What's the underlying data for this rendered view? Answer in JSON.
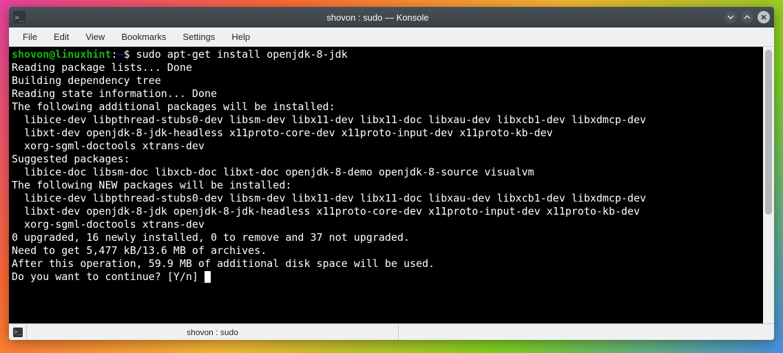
{
  "window": {
    "title": "shovon : sudo — Konsole"
  },
  "menubar": {
    "items": [
      "File",
      "Edit",
      "View",
      "Bookmarks",
      "Settings",
      "Help"
    ]
  },
  "prompt": {
    "userhost": "shovon@linuxhint",
    "sep": ":",
    "cwd": "~",
    "sigil": "$ ",
    "command": "sudo apt-get install openjdk-8-jdk"
  },
  "lines": {
    "l1": "Reading package lists... Done",
    "l2": "Building dependency tree       ",
    "l3": "Reading state information... Done",
    "l4": "The following additional packages will be installed:",
    "l5": "  libice-dev libpthread-stubs0-dev libsm-dev libx11-dev libx11-doc libxau-dev libxcb1-dev libxdmcp-dev",
    "l6": "  libxt-dev openjdk-8-jdk-headless x11proto-core-dev x11proto-input-dev x11proto-kb-dev",
    "l7": "  xorg-sgml-doctools xtrans-dev",
    "l8": "Suggested packages:",
    "l9": "  libice-doc libsm-doc libxcb-doc libxt-doc openjdk-8-demo openjdk-8-source visualvm",
    "l10": "The following NEW packages will be installed:",
    "l11": "  libice-dev libpthread-stubs0-dev libsm-dev libx11-dev libx11-doc libxau-dev libxcb1-dev libxdmcp-dev",
    "l12": "  libxt-dev openjdk-8-jdk openjdk-8-jdk-headless x11proto-core-dev x11proto-input-dev x11proto-kb-dev",
    "l13": "  xorg-sgml-doctools xtrans-dev",
    "l14": "0 upgraded, 16 newly installed, 0 to remove and 37 not upgraded.",
    "l15": "Need to get 5,477 kB/13.6 MB of archives.",
    "l16": "After this operation, 59.9 MB of additional disk space will be used.",
    "l17": "Do you want to continue? [Y/n] "
  },
  "tab": {
    "label": "shovon : sudo"
  }
}
